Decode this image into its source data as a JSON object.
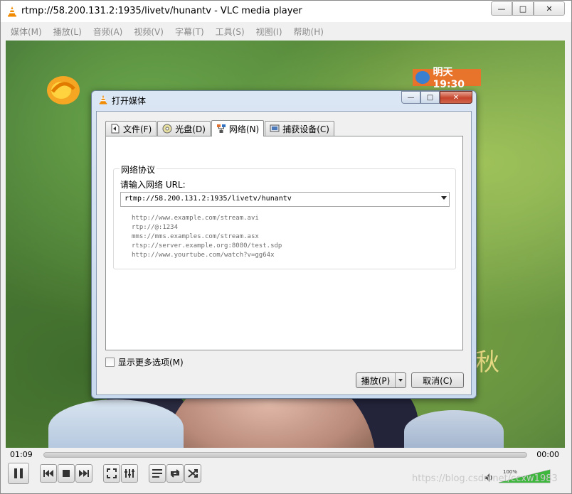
{
  "window": {
    "title": "rtmp://58.200.131.2:1935/livetv/hunantv - VLC media player",
    "min_glyph": "—",
    "max_glyph": "□",
    "close_glyph": "✕"
  },
  "menubar": {
    "items": [
      "媒体(M)",
      "播放(L)",
      "音频(A)",
      "视频(V)",
      "字幕(T)",
      "工具(S)",
      "视图(I)",
      "帮助(H)"
    ]
  },
  "video": {
    "channel_badge": "明天19:30",
    "overlay_text": "秋"
  },
  "playback": {
    "elapsed": "01:09",
    "total": "00:00",
    "volume": "100%",
    "volume_level": 1.0
  },
  "dialog": {
    "title": "打开媒体",
    "tabs": [
      "文件(F)",
      "光盘(D)",
      "网络(N)",
      "捕获设备(C)"
    ],
    "active_tab": 2,
    "group_title": "网络协议",
    "url_label": "请输入网络 URL:",
    "url_value": "rtmp://58.200.131.2:1935/livetv/hunantv",
    "examples": [
      "http://www.example.com/stream.avi",
      "rtp://@:1234",
      "mms://mms.examples.com/stream.asx",
      "rtsp://server.example.org:8080/test.sdp",
      "http://www.yourtube.com/watch?v=gg64x"
    ],
    "more_options": "显示更多选项(M)",
    "play_button": "播放(P)",
    "cancel_button": "取消(C)"
  },
  "watermark": "https://blog.csdn.net/ccxw1983",
  "colors": {
    "vlc_orange": "#f08a00",
    "dialog_frame": "#c9d9ee",
    "close_red": "#c6452c",
    "volume_green": "#3db83d"
  }
}
